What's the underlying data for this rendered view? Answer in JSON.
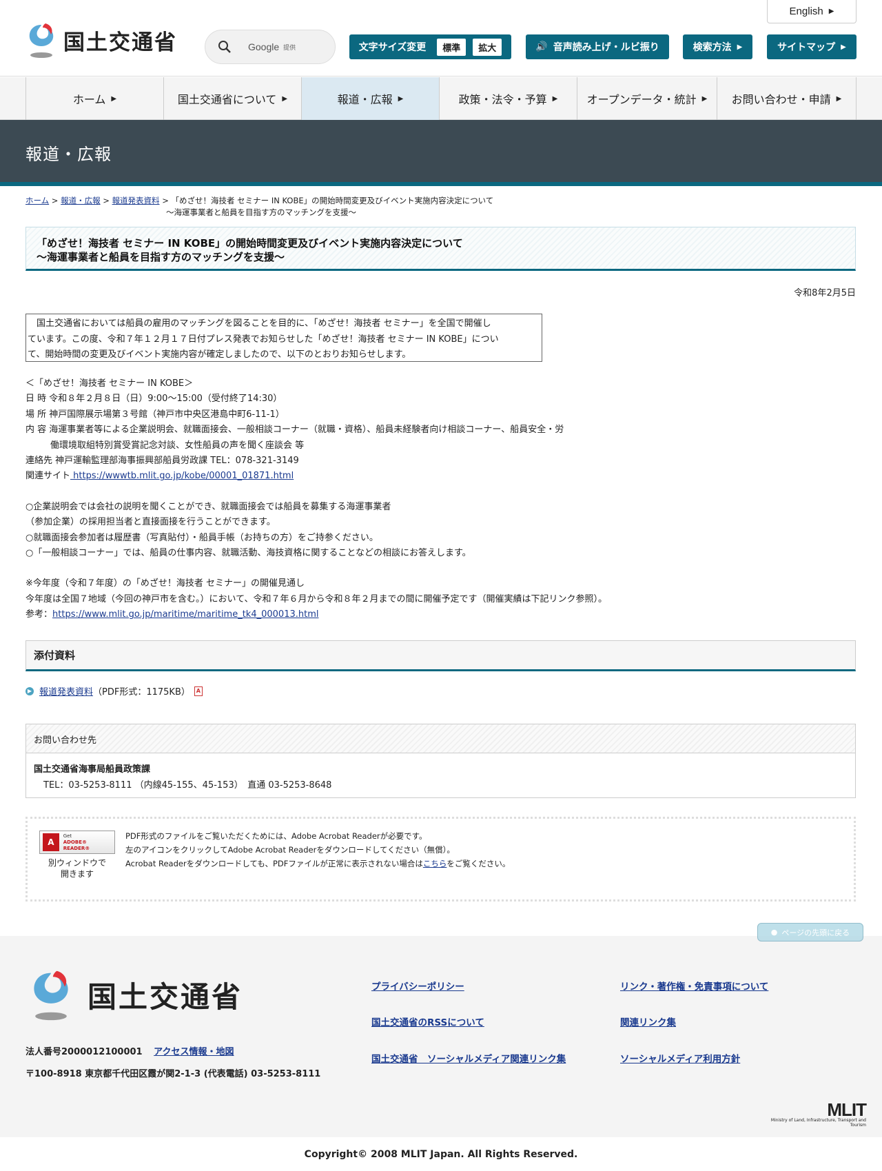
{
  "header": {
    "site_name": "国土交通省",
    "english": "English",
    "search_placeholder": "Google",
    "search_sub": "提供",
    "font_size_label": "文字サイズ変更",
    "font_size_standard": "標準",
    "font_size_large": "拡大",
    "read_aloud": "音声読み上げ・ルビ振り",
    "search_method": "検索方法",
    "sitemap": "サイトマップ"
  },
  "gnav": [
    "ホーム",
    "国土交通省について",
    "報道・広報",
    "政策・法令・予算",
    "オープンデータ・統計",
    "お問い合わせ・申請"
  ],
  "banner_title": "報道・広報",
  "breadcrumb": {
    "home": "ホーム",
    "press": "報道・広報",
    "release": "報道発表資料",
    "current_line1": "「めざせ！海技者 セミナー IN KOBE」の開始時間変更及びイベント実施内容決定について",
    "current_line2": "～海運事業者と船員を目指す方のマッチングを支援～"
  },
  "title": {
    "line1": "「めざせ！海技者 セミナー IN KOBE」の開始時間変更及びイベント実施内容決定について",
    "line2": "～海運事業者と船員を目指す方のマッチングを支援～"
  },
  "date": "令和8年2月5日",
  "lead": {
    "line1": "　国土交通省においては船員の雇用のマッチングを図ることを目的に、「めざせ！海技者 セミナー」を全国で開催し",
    "line2": "ています。この度、令和７年１２月１７日付プレス発表でお知らせした「めざせ！海技者 セミナー IN KOBE」につい",
    "line3": "て、開始時間の変更及びイベント実施内容が確定しましたので、以下のとおりお知らせします。"
  },
  "event": {
    "heading": "＜「めざせ！海技者 セミナー IN KOBE＞",
    "datetime": "日 時 令和８年２月８日（日）9:00～15:00（受付終了14:30）",
    "place": "場 所 神戸国際展示場第３号館（神戸市中央区港島中町6-11-1）",
    "content1": "内 容 海運事業者等による企業説明会、就職面接会、一般相談コーナー（就職・資格）、船員未経験者向け相談コーナー、船員安全・労",
    "content2": "働環境取組特別賞受賞記念対談、女性船員の声を聞く座談会 等",
    "contact": "連絡先 神戸運輸監理部海事振興部船員労政課 TEL：078-321-3149",
    "related_label": "関連サイト",
    "related_url": " https://wwwtb.mlit.go.jp/kobe/00001_01871.html"
  },
  "notes": {
    "n1a": "○企業説明会では会社の説明を聞くことができ、就職面接会では船員を募集する海運事業者",
    "n1b": "（参加企業）の採用担当者と直接面接を行うことができます。",
    "n2": "○就職面接会参加者は履歴書（写真貼付）・船員手帳（お持ちの方）をご持参ください。",
    "n3": "○「一般相談コーナー」では、船員の仕事内容、就職活動、海技資格に関することなどの相談にお答えします。"
  },
  "outlook": {
    "title": "※今年度（令和７年度）の「めざせ！海技者 セミナー」の開催見通し",
    "text": "今年度は全国７地域（今回の神戸市を含む。）において、令和７年６月から令和８年２月までの間に開催予定です（開催実績は下記リンク参照）。",
    "ref_label": "参考：",
    "ref_url": "https://www.mlit.go.jp/maritime/maritime_tk4_000013.html"
  },
  "attachment": {
    "heading": "添付資料",
    "link": "報道発表資料",
    "info": "（PDF形式：1175KB）"
  },
  "contact": {
    "heading": "お問い合わせ先",
    "dept": "国土交通省海事局船員政策課",
    "tel": "TEL：03-5253-8111 （内線45-155、45-153）　直通 03-5253-8648"
  },
  "adobe": {
    "badge_get": "Get",
    "badge_name": "ADOBE® READER®",
    "caption1": "別ウィンドウで",
    "caption2": "開きます",
    "line1": "PDF形式のファイルをご覧いただくためには、Adobe Acrobat Readerが必要です。",
    "line2": "左のアイコンをクリックしてAdobe Acrobat Readerをダウンロードしてください（無償）。",
    "line3a": "Acrobat Readerをダウンロードしても、PDFファイルが正常に表示されない場合は",
    "line3_link": "こちら",
    "line3b": "をご覧ください。"
  },
  "pagetop": "ページの先頭に戻る",
  "footer": {
    "site_name": "国土交通省",
    "corp_no": "法人番号2000012100001",
    "access": "アクセス情報・地図",
    "address": "〒100-8918 東京都千代田区霞が関2-1-3 (代表電話) 03-5253-8111",
    "links": [
      "プライバシーポリシー",
      "リンク・著作権・免責事項について",
      "国土交通省のRSSについて",
      "関連リンク集",
      "国土交通省　ソーシャルメディア関連リンク集",
      "ソーシャルメディア利用方針"
    ],
    "mlit_big": "MLIT",
    "mlit_small": "Ministry of Land, Infrastructure, Transport and Tourism"
  },
  "copyright": "Copyright© 2008 MLIT Japan. All Rights Reserved."
}
